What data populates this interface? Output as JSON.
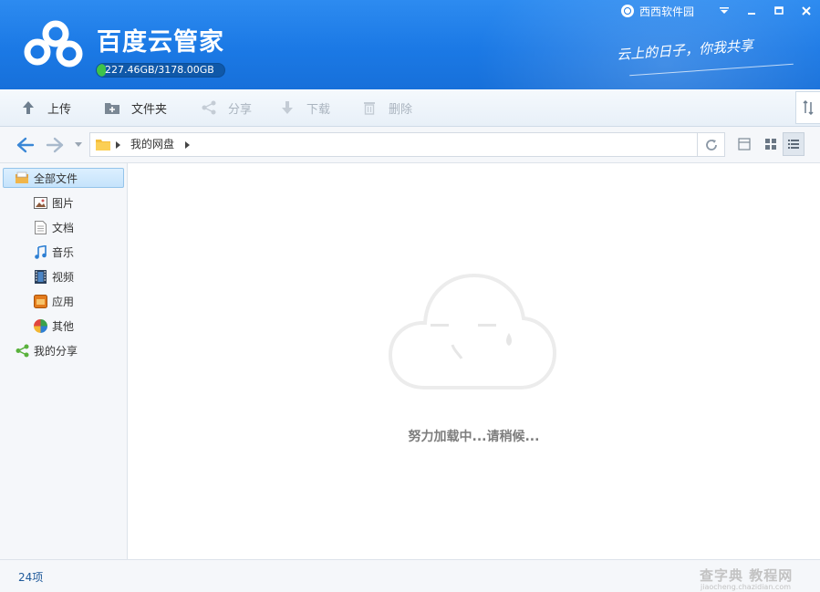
{
  "app": {
    "title": "百度云管家",
    "quota_text": "227.46GB/3178.00GB",
    "quota_used_fraction": 0.0716,
    "slogan": "云上的日子，你我共享"
  },
  "titlebar": {
    "badge_label": "西西软件园",
    "dropdown_icon": "menu-dropdown-icon",
    "minimize_icon": "minimize-icon",
    "maximize_icon": "maximize-icon",
    "close_icon": "close-icon"
  },
  "toolbar": {
    "upload": "上传",
    "new_folder": "文件夹",
    "share": "分享",
    "download": "下载",
    "delete": "删除"
  },
  "nav": {
    "path_root": "我的网盘"
  },
  "sidebar": {
    "items": [
      {
        "label": "全部文件",
        "icon": "all-files-icon"
      },
      {
        "label": "图片",
        "icon": "picture-icon"
      },
      {
        "label": "文档",
        "icon": "document-icon"
      },
      {
        "label": "音乐",
        "icon": "music-icon"
      },
      {
        "label": "视频",
        "icon": "video-icon"
      },
      {
        "label": "应用",
        "icon": "app-icon"
      },
      {
        "label": "其他",
        "icon": "other-icon"
      },
      {
        "label": "我的分享",
        "icon": "share-icon"
      }
    ]
  },
  "content": {
    "loading_text": "努力加载中...请稍候..."
  },
  "status": {
    "item_count": "24项",
    "watermark": "查字典 教程网",
    "watermark_sub": "jiaocheng.chazidian.com"
  },
  "colors": {
    "header_blue": "#1b79e5",
    "quota_green": "#3ec34a",
    "selected_bg": "#c5e3fb"
  }
}
